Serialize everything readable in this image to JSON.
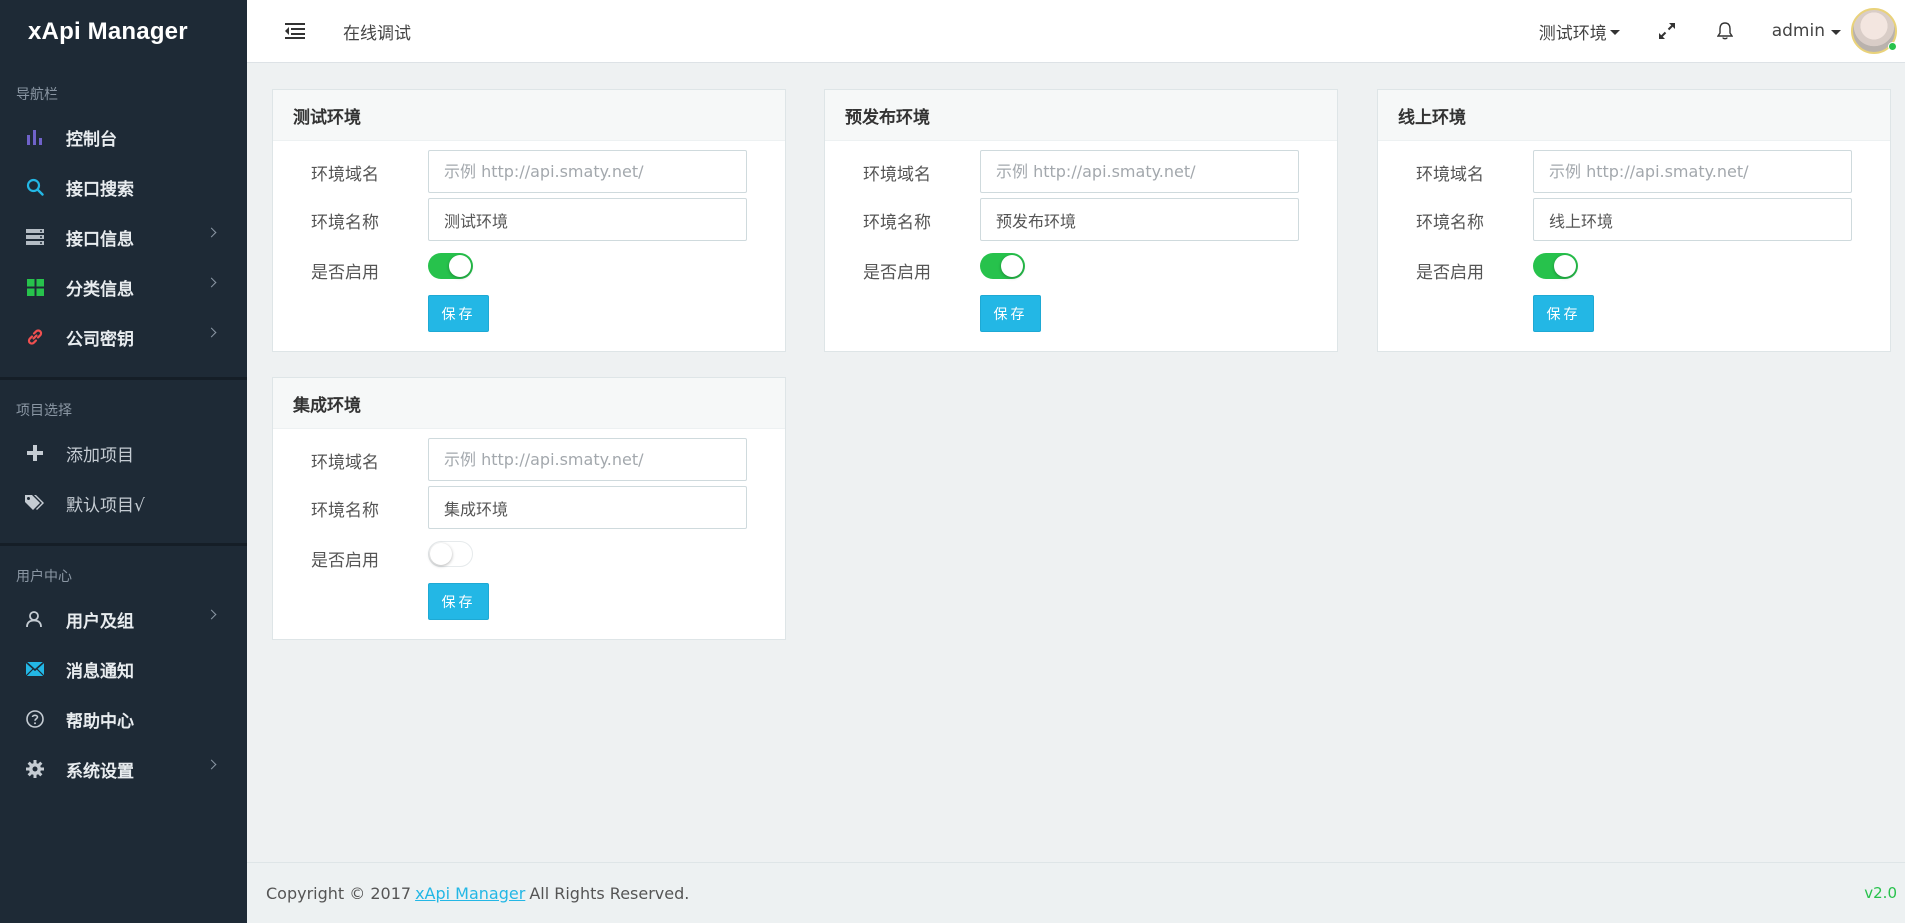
{
  "brand": "xApi Manager",
  "sidebar": {
    "section_nav": "导航栏",
    "nav_items": [
      {
        "label": "控制台",
        "icon": "bar-chart-icon"
      },
      {
        "label": "接口搜索",
        "icon": "search-icon"
      },
      {
        "label": "接口信息",
        "icon": "server-icon"
      },
      {
        "label": "分类信息",
        "icon": "grid-icon"
      },
      {
        "label": "公司密钥",
        "icon": "link-icon"
      }
    ],
    "section_project": "项目选择",
    "project_items": [
      {
        "label": "添加项目",
        "icon": "plus-icon"
      },
      {
        "label": "默认项目√",
        "icon": "tags-icon"
      }
    ],
    "section_user": "用户中心",
    "user_items": [
      {
        "label": "用户及组",
        "icon": "user-icon"
      },
      {
        "label": "消息通知",
        "icon": "envelope-icon"
      },
      {
        "label": "帮助中心",
        "icon": "help-icon"
      },
      {
        "label": "系统设置",
        "icon": "gear-icon"
      }
    ]
  },
  "header": {
    "page_label": "在线调试",
    "env_select": "测试环境",
    "username": "admin"
  },
  "panels": [
    {
      "title": "测试环境",
      "domain_label": "环境域名",
      "domain_value": "",
      "domain_placeholder": "示例 http://api.smaty.net/",
      "name_label": "环境名称",
      "name_value": "测试环境",
      "enabled_label": "是否启用",
      "enabled": true,
      "save_label": "保存"
    },
    {
      "title": "预发布环境",
      "domain_label": "环境域名",
      "domain_value": "",
      "domain_placeholder": "示例 http://api.smaty.net/",
      "name_label": "环境名称",
      "name_value": "预发布环境",
      "enabled_label": "是否启用",
      "enabled": true,
      "save_label": "保存"
    },
    {
      "title": "线上环境",
      "domain_label": "环境域名",
      "domain_value": "",
      "domain_placeholder": "示例 http://api.smaty.net/",
      "name_label": "环境名称",
      "name_value": "线上环境",
      "enabled_label": "是否启用",
      "enabled": true,
      "save_label": "保存"
    },
    {
      "title": "集成环境",
      "domain_label": "环境域名",
      "domain_value": "",
      "domain_placeholder": "示例 http://api.smaty.net/",
      "name_label": "环境名称",
      "name_value": "集成环境",
      "enabled_label": "是否启用",
      "enabled": false,
      "save_label": "保存"
    }
  ],
  "footer": {
    "copyright": "Copyright © 2017",
    "link": "xApi Manager",
    "rights": "All Rights Reserved.",
    "version": "v2.0"
  },
  "colors": {
    "sidebar_bg": "#1e2a36",
    "accent_blue": "#23b7e5",
    "toggle_on": "#27c24c",
    "bar_chart_icon": "#6f62c9",
    "search_icon": "#23b7e5",
    "grid_icon": "#27c24c",
    "link_icon": "#f05050"
  }
}
